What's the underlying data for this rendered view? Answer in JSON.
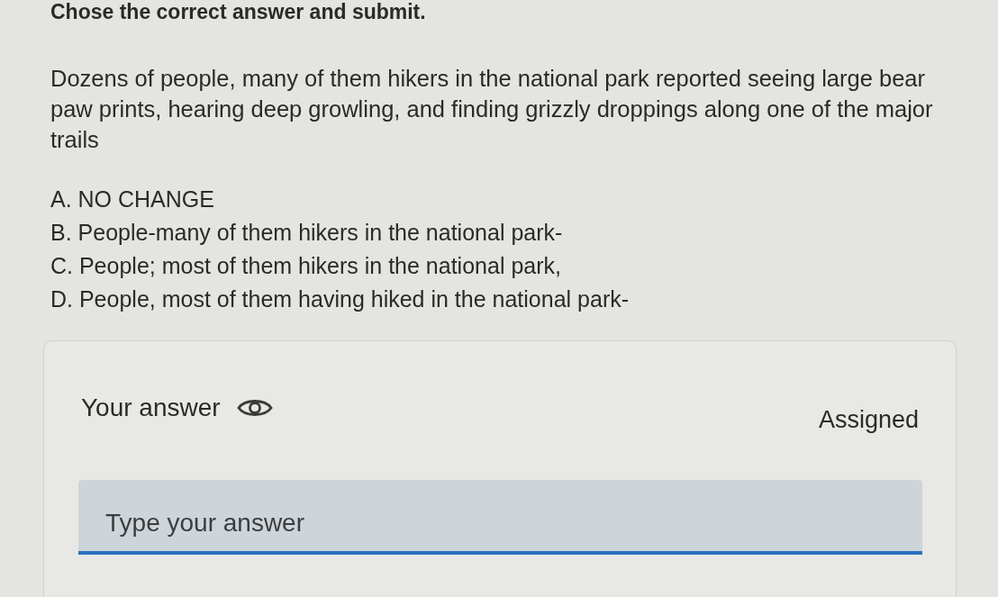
{
  "instruction": "Chose the correct answer and submit.",
  "passage": "Dozens of people, many of them hikers in the national park reported seeing large bear paw prints, hearing deep growling, and finding grizzly droppings along one of the major trails",
  "options": [
    "A. NO CHANGE",
    "B. People-many of them hikers in the national park-",
    "C. People; most of them hikers in the national park,",
    "D. People, most of them having hiked in the national park-"
  ],
  "answer_card": {
    "label": "Your answer",
    "status": "Assigned",
    "field": {
      "placeholder": "Type your answer",
      "focused": true
    }
  }
}
